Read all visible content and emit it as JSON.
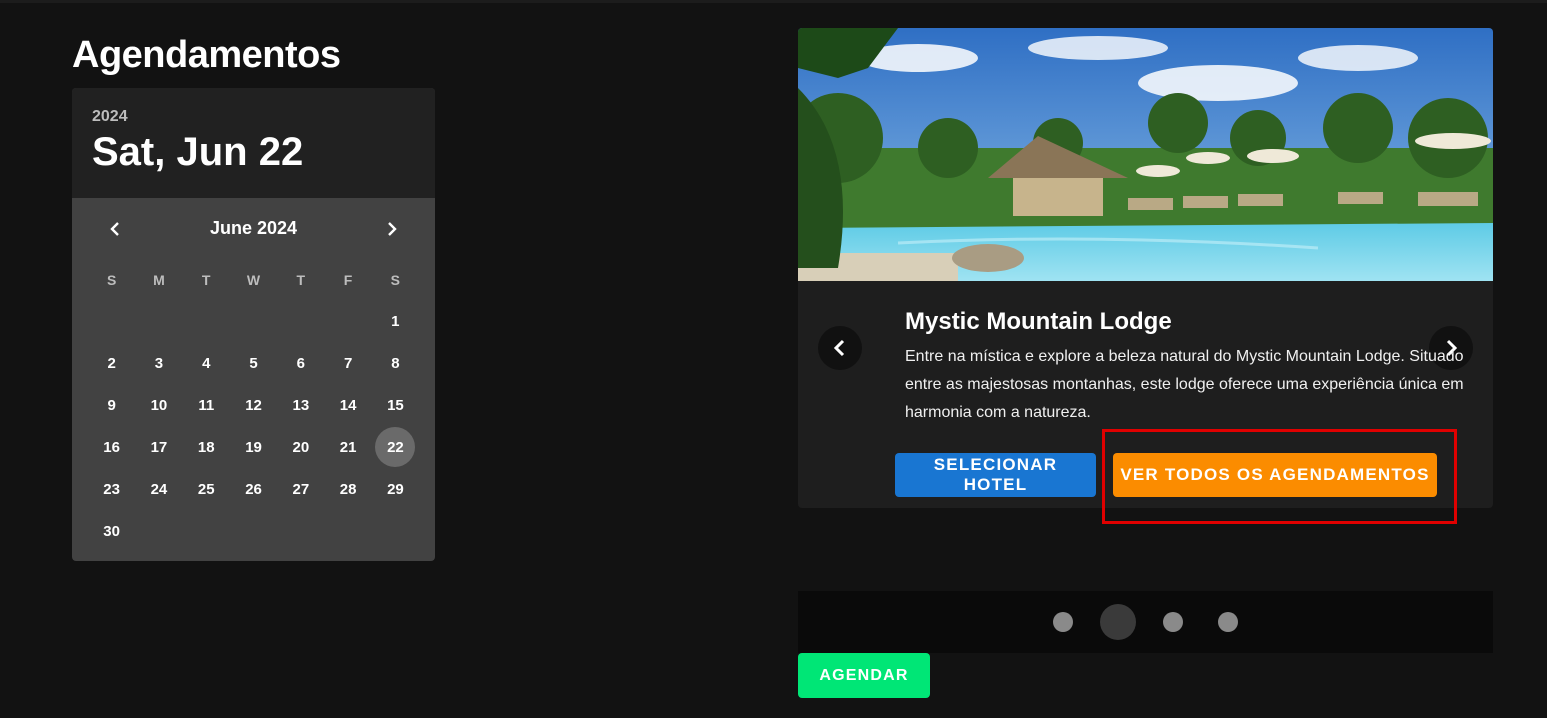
{
  "page": {
    "title": "Agendamentos"
  },
  "picker": {
    "year": "2024",
    "selected_date": "Sat, Jun 22",
    "month_label": "June 2024",
    "weekdays": [
      "S",
      "M",
      "T",
      "W",
      "T",
      "F",
      "S"
    ],
    "weeks": [
      [
        "",
        "",
        "",
        "",
        "",
        "",
        "1"
      ],
      [
        "2",
        "3",
        "4",
        "5",
        "6",
        "7",
        "8"
      ],
      [
        "9",
        "10",
        "11",
        "12",
        "13",
        "14",
        "15"
      ],
      [
        "16",
        "17",
        "18",
        "19",
        "20",
        "21",
        "22"
      ],
      [
        "23",
        "24",
        "25",
        "26",
        "27",
        "28",
        "29"
      ],
      [
        "30",
        "",
        "",
        "",
        "",
        "",
        ""
      ]
    ],
    "selected_day": "22"
  },
  "carousel": {
    "hotel_name": "Mystic Mountain Lodge",
    "description": "Entre na mística e explore a beleza natural do Mystic Mountain Lodge. Situado entre as majestosas montanhas, este lodge oferece uma experiência única em harmonia com a natureza.",
    "select_label": "SELECIONAR HOTEL",
    "all_label": "VER TODOS OS AGENDAMENTOS",
    "slide_count": 4,
    "active_slide": 2
  },
  "actions": {
    "schedule_label": "AGENDAR"
  },
  "colors": {
    "primary": "#1976d2",
    "orange": "#fb8c00",
    "green": "#00e676",
    "highlight": "#e00000"
  }
}
